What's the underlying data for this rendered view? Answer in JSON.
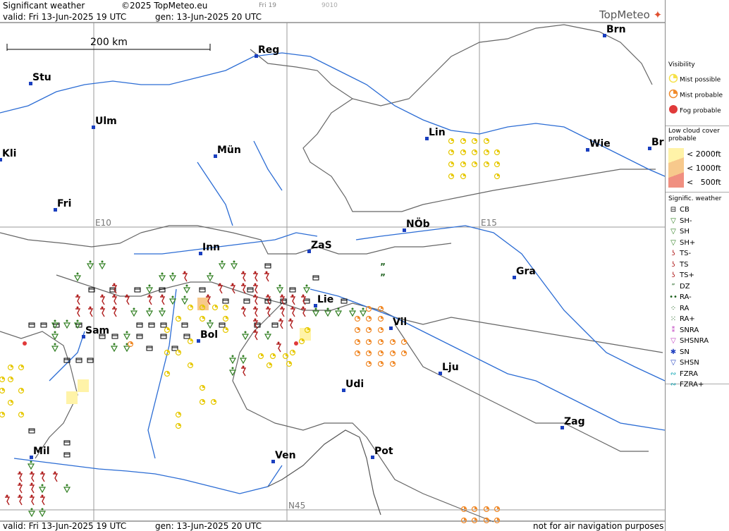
{
  "header": {
    "title": "Significant weather",
    "copyright": "©2025 TopMeteo.eu",
    "day": "Fri 19",
    "code": "9010",
    "valid_line": "valid:  Fri  13-Jun-2025  19 UTC",
    "gen_line": "gen: 13-Jun-2025  20 UTC",
    "logo": "TopMeteo"
  },
  "footer": {
    "valid_line": "valid:  Fri  13-Jun-2025  19 UTC",
    "gen_line": "gen: 13-Jun-2025  20 UTC",
    "disclaimer": "not for air navigation purposes"
  },
  "scale_label": "200 km",
  "grid_labels": {
    "e10": "E10",
    "e15": "E15",
    "n45": "N45"
  },
  "cities": [
    {
      "name": "Brn"
    },
    {
      "name": "Reg"
    },
    {
      "name": "Stu"
    },
    {
      "name": "Ulm"
    },
    {
      "name": "Lin"
    },
    {
      "name": "Mün"
    },
    {
      "name": "Wie"
    },
    {
      "name": "Br"
    },
    {
      "name": "Kli"
    },
    {
      "name": "Fri"
    },
    {
      "name": "NÖb"
    },
    {
      "name": "Inn"
    },
    {
      "name": "ZaS"
    },
    {
      "name": "Gra"
    },
    {
      "name": "Lie"
    },
    {
      "name": "Vil"
    },
    {
      "name": "Sam"
    },
    {
      "name": "Bol"
    },
    {
      "name": "Lju"
    },
    {
      "name": "Udi"
    },
    {
      "name": "Zag"
    },
    {
      "name": "Mil"
    },
    {
      "name": "Pot"
    },
    {
      "name": "Ven"
    }
  ],
  "legend": {
    "visibility_title": "Visibility",
    "visibility": [
      {
        "label": "Mist possible",
        "color": "#f5e14b"
      },
      {
        "label": "Mist probable",
        "color": "#f08a2a"
      },
      {
        "label": "Fog probable",
        "color": "#e03a3a"
      }
    ],
    "cloud_title": "Low cloud cover probable",
    "cloud": [
      {
        "label": "< 2000ft",
        "color": "#fff3a8"
      },
      {
        "label": "< 1000ft",
        "color": "#f7c98c"
      },
      {
        "label": "<   500ft",
        "color": "#f08f80"
      }
    ],
    "weather_title": "Signific. weather",
    "weather": [
      {
        "label": "CB",
        "icon": "cb-icon",
        "color": "#000000"
      },
      {
        "label": "SH-",
        "icon": "shower-light-icon",
        "color": "#2e7d1f"
      },
      {
        "label": "SH",
        "icon": "shower-icon",
        "color": "#2e7d1f"
      },
      {
        "label": "SH+",
        "icon": "shower-heavy-icon",
        "color": "#2e7d1f"
      },
      {
        "label": "TS-",
        "icon": "thunderstorm-light-icon",
        "color": "#b01e1e"
      },
      {
        "label": "TS",
        "icon": "thunderstorm-icon",
        "color": "#b01e1e"
      },
      {
        "label": "TS+",
        "icon": "thunderstorm-heavy-icon",
        "color": "#b01e1e"
      },
      {
        "label": "DZ",
        "icon": "drizzle-icon",
        "color": "#1a5e1a"
      },
      {
        "label": "RA-",
        "icon": "rain-light-icon",
        "color": "#1a5e1a"
      },
      {
        "label": "RA",
        "icon": "rain-icon",
        "color": "#1a5e1a"
      },
      {
        "label": "RA+",
        "icon": "rain-heavy-icon",
        "color": "#1a5e1a"
      },
      {
        "label": "SNRA",
        "icon": "sleet-icon",
        "color": "#c040c0"
      },
      {
        "label": "SHSNRA",
        "icon": "sleet-shower-icon",
        "color": "#c040c0"
      },
      {
        "label": "SN",
        "icon": "snow-icon",
        "color": "#2040c0"
      },
      {
        "label": "SHSN",
        "icon": "snow-shower-icon",
        "color": "#2040c0"
      },
      {
        "label": "FZRA",
        "icon": "freezing-rain-icon",
        "color": "#00a0b0"
      },
      {
        "label": "FZRA+",
        "icon": "freezing-rain-heavy-icon",
        "color": "#00a0b0"
      }
    ]
  },
  "colors": {
    "border": "#555555",
    "river": "#2b6cd4",
    "grid": "#999999",
    "city_marker": "#1a3fbf"
  }
}
